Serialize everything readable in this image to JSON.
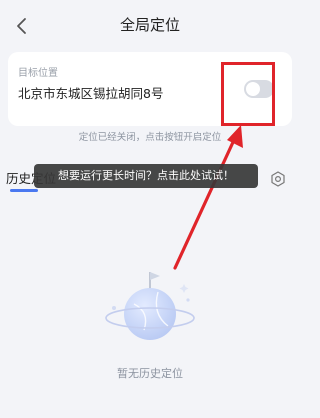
{
  "header": {
    "title": "全局定位",
    "back_icon": "chevron-left-icon"
  },
  "target_card": {
    "label": "目标位置",
    "address": "北京市东城区锡拉胡同8号",
    "toggle_on": false,
    "hint": "定位已经关闭，点击按钮开启定位"
  },
  "history": {
    "title": "历史定位",
    "settings_icon": "gear-icon"
  },
  "tooltip": {
    "text": "想要运行更长时间？点击此处试试！"
  },
  "empty_state": {
    "text": "暂无历史定位",
    "illustration_icon": "planet-flag-icon"
  },
  "colors": {
    "accent": "#4a78f0",
    "annotation_red": "#e0242a",
    "background": "#f3f4f8"
  }
}
